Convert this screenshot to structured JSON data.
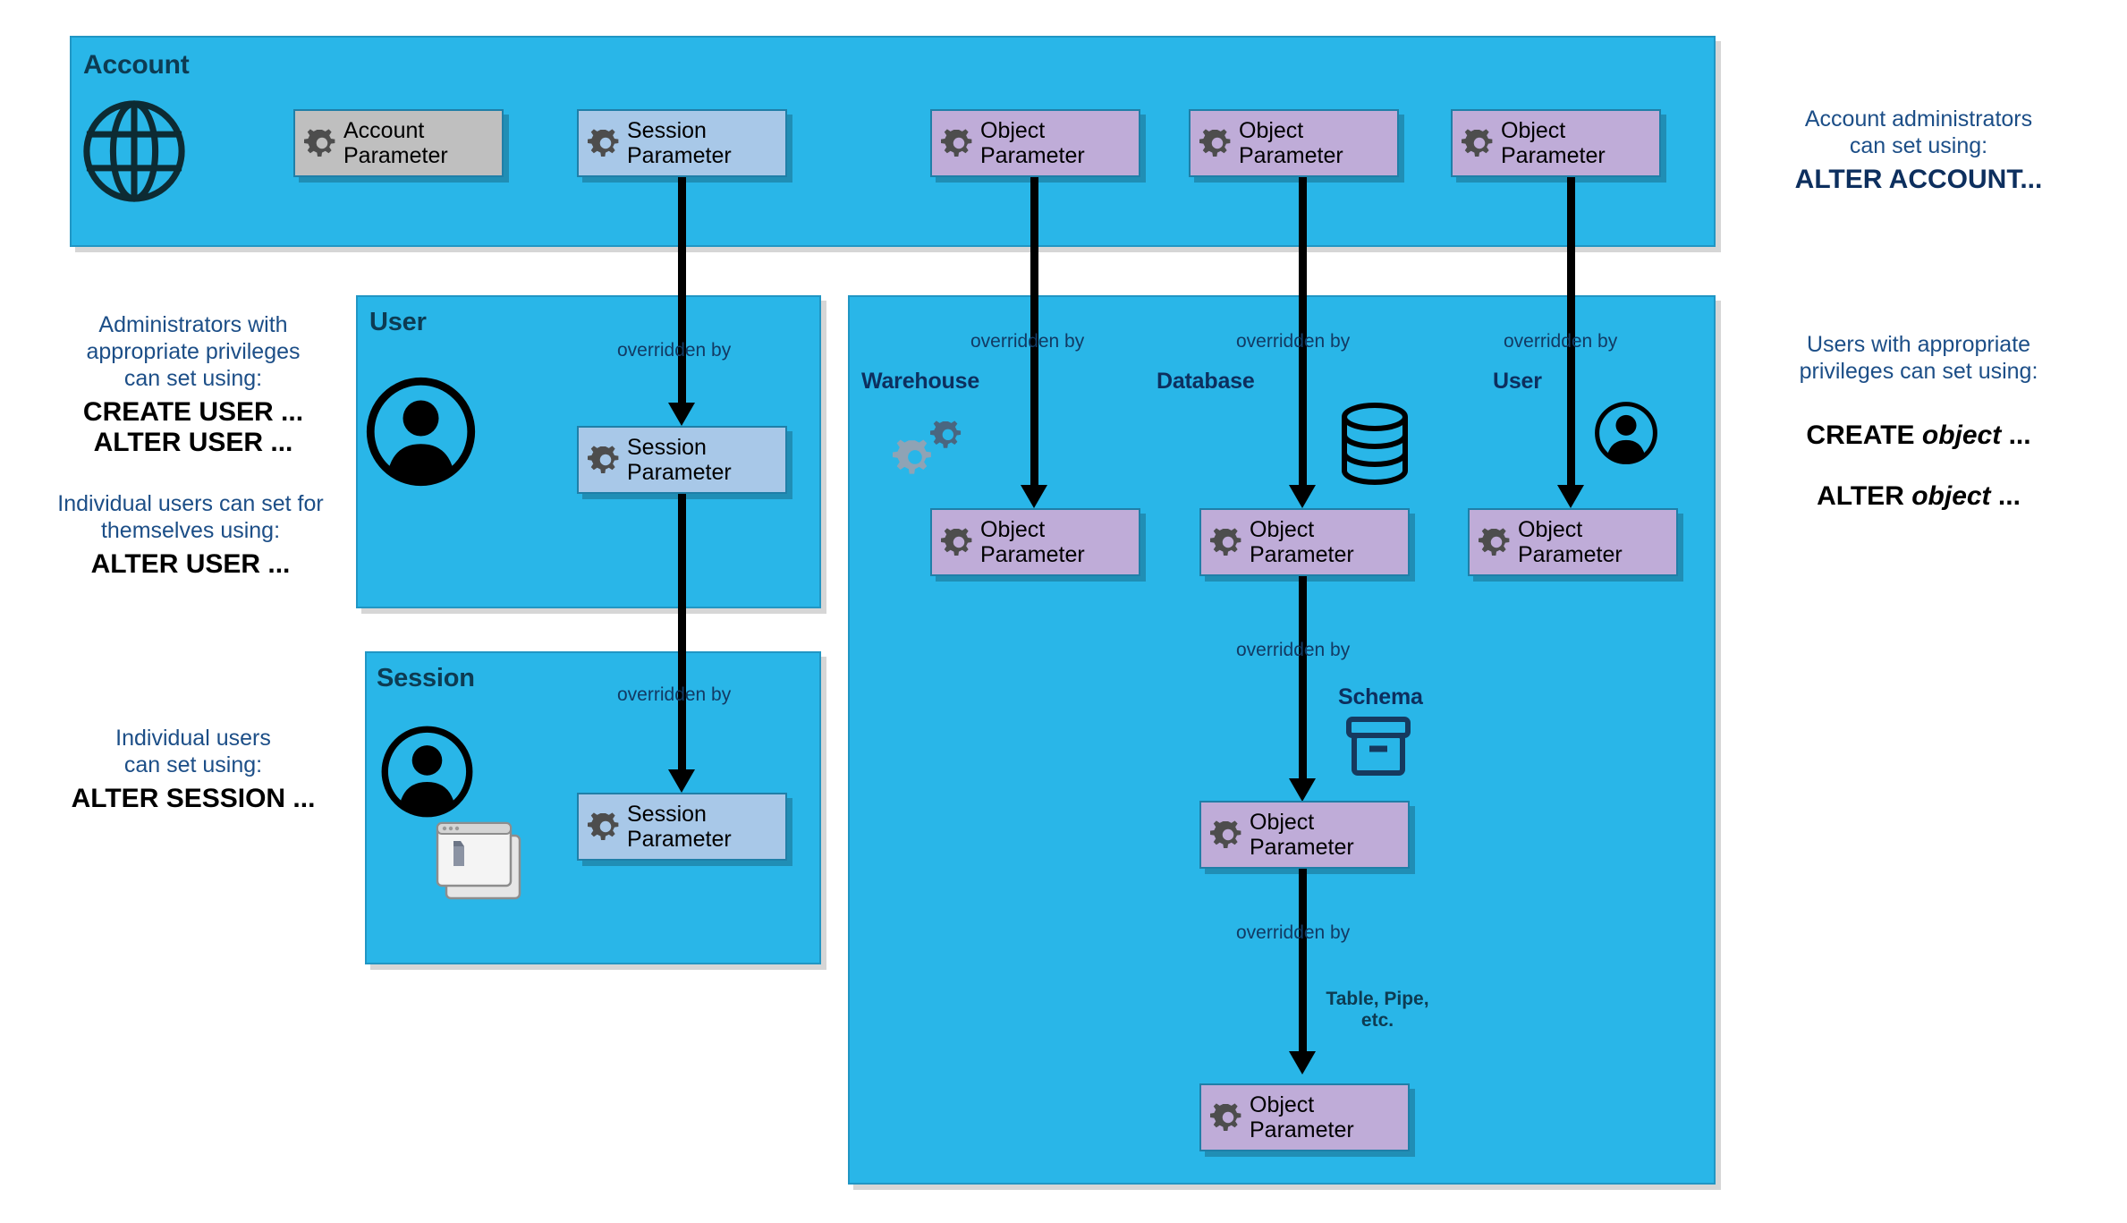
{
  "diagram": {
    "title": "Snowflake parameter hierarchy",
    "colors": {
      "panel_fill": "#29b6e8",
      "panel_border": "#2196c4",
      "account_param_fill": "#bfbfbf",
      "session_param_fill": "#a8c8e8",
      "object_param_fill": "#bfacd8",
      "param_border": "#1f7fa8",
      "arrow": "#000000",
      "panel_title_text": "#0d3b52",
      "note_desc_text": "#1c4e87",
      "note_cmd_text": "#000000",
      "note_cmd_navy_text": "#0d2f5e"
    },
    "labels": {
      "overridden_by": "overridden by",
      "table_pipe_etc": "Table, Pipe,\netc."
    },
    "panels": {
      "account": {
        "title": "Account",
        "icon": "globe-icon"
      },
      "user": {
        "title": "User",
        "icon": "person-avatar-icon"
      },
      "session": {
        "title": "Session",
        "icons": [
          "person-avatar-icon",
          "application-window-icon"
        ]
      },
      "objects": {
        "title": ""
      }
    },
    "group_labels": {
      "warehouse": "Warehouse",
      "database": "Database",
      "user": "User",
      "schema": "Schema"
    },
    "boxes": {
      "account_parameter": "Account\nParameter",
      "session_parameter": "Session\nParameter",
      "object_parameter": "Object\nParameter"
    },
    "notes": {
      "account_admin": {
        "desc": "Account administrators\ncan set using:",
        "cmd": "ALTER ACCOUNT..."
      },
      "user_admin": {
        "desc": "Administrators with\nappropriate privileges\ncan set using:",
        "cmd_line1": "CREATE USER ...",
        "cmd_line2": "ALTER USER ..."
      },
      "user_self": {
        "desc": "Individual users can set for\nthemselves using:",
        "cmd": "ALTER USER ..."
      },
      "session_self": {
        "desc": "Individual users\ncan set using:",
        "cmd": "ALTER SESSION ..."
      },
      "object_users": {
        "desc": "Users with appropriate\nprivileges can set using:",
        "cmd_line1_pre": "CREATE ",
        "cmd_line1_em": "object",
        "cmd_line1_post": " ...",
        "cmd_line2_pre": "ALTER ",
        "cmd_line2_em": "object",
        "cmd_line2_post": " ..."
      }
    }
  }
}
